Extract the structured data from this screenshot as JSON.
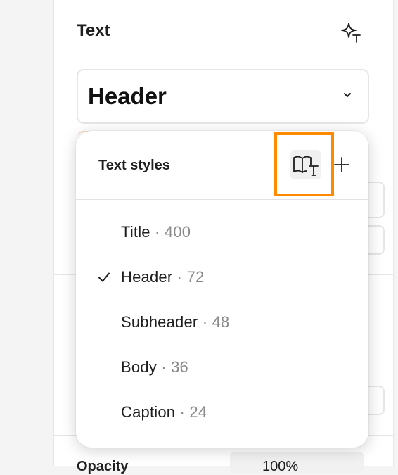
{
  "panel": {
    "section_title": "Text",
    "font_select_value": "Header",
    "opacity_label": "Opacity",
    "opacity_value": "100%"
  },
  "popover": {
    "title": "Text styles",
    "styles": [
      {
        "name": "Title",
        "sep": " · ",
        "size": "400",
        "selected": false
      },
      {
        "name": "Header",
        "sep": " · ",
        "size": "72",
        "selected": true
      },
      {
        "name": "Subheader",
        "sep": " · ",
        "size": "48",
        "selected": false
      },
      {
        "name": "Body",
        "sep": " · ",
        "size": "36",
        "selected": false
      },
      {
        "name": "Caption",
        "sep": " · ",
        "size": "24",
        "selected": false
      }
    ]
  },
  "icons": {
    "sparkle_text": "sparkle-text-icon",
    "chevron": "chevron-down-icon",
    "library": "book-text-icon",
    "add": "plus-icon",
    "check": "checkmark-icon"
  },
  "colors": {
    "highlight": "#ff8a00",
    "panel_bg": "#ffffff",
    "page_bg": "#f4f4f4",
    "border": "#e6e6e6",
    "muted_text": "#8a8a8a"
  }
}
